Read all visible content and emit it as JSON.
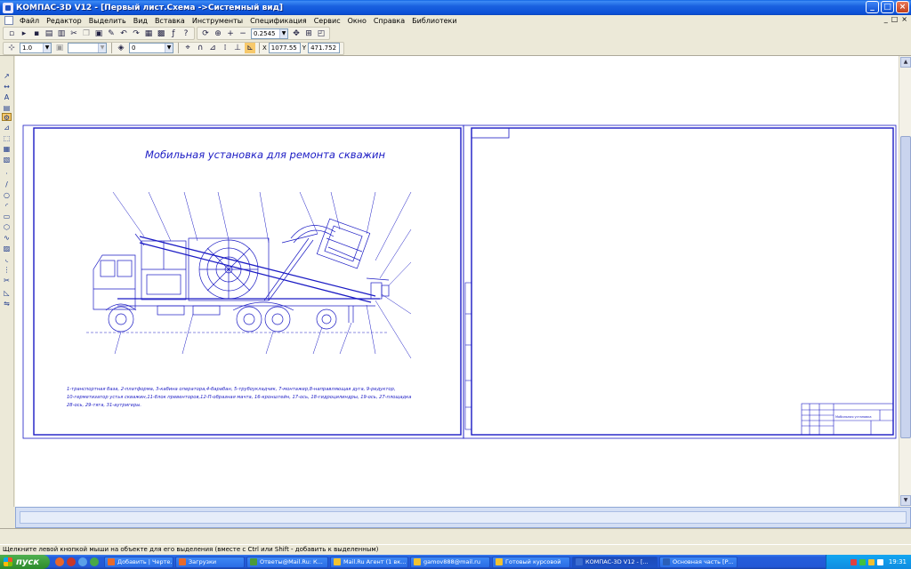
{
  "window": {
    "title": "КОМПАС-3D V12 - [Первый лист.Схема ->Системный вид]",
    "min_label": "_",
    "max_label": "□",
    "close_label": "×"
  },
  "menu": {
    "items": [
      "Файл",
      "Редактор",
      "Выделить",
      "Вид",
      "Вставка",
      "Инструменты",
      "Спецификация",
      "Сервис",
      "Окно",
      "Справка",
      "Библиотеки"
    ],
    "mdi_controls": [
      "_",
      "□",
      "×"
    ]
  },
  "toolbar": {
    "zoom_value": "0.2545",
    "line_scale": "1.0",
    "layer_value": "0",
    "coord_x_label": "X",
    "coord_x": "1077.55",
    "coord_y_label": "Y",
    "coord_y": "471.752"
  },
  "drawing": {
    "title": "Мобильная установка для ремонта скважин",
    "legend_line1": "1-транспортная база, 2-платформа, 3-кабина оператора,4-барабан, 5-трубоукладчик, 7-монтажер,8-направляющая дуга, 9-редуктор,",
    "legend_line2": "10-герметизатор устья скважин,11-блок превенторов,12-П-образная мачта, 16-кронштейн, 17-ось, 18-гидроцилиндры, 19-ось, 27-площадка",
    "legend_line3": "28-ось, 29-тяга, 31-аутригеры.",
    "stamp_text": "Мобильная установка"
  },
  "statusbar": {
    "hint": "Щелкните левой кнопкой мыши на объекте для его выделения (вместе с Ctrl или Shift - добавить к выделенным)"
  },
  "taskbar": {
    "start_label": "пуск",
    "items": [
      {
        "label": "Добавить | Черте...",
        "color": "#e86a2a"
      },
      {
        "label": "Загрузки",
        "color": "#e86a2a"
      },
      {
        "label": "Ответы@Mail.Ru: К...",
        "color": "#4a9a3a"
      },
      {
        "label": "Mail.Ru Агент (1 вк...",
        "color": "#f2c230"
      },
      {
        "label": "gamov888@mail.ru",
        "color": "#f2c230"
      },
      {
        "label": "Готовый курсовой",
        "color": "#f2c230"
      },
      {
        "label": "КОМПАС-3D V12 - [...",
        "color": "#3a6cd0"
      },
      {
        "label": "Основная часть [Р...",
        "color": "#2b5fb8"
      }
    ],
    "clock": "19:31"
  },
  "colors": {
    "drawing_blue": "#1b1bc4",
    "titlebar": "#0b4fd6"
  }
}
